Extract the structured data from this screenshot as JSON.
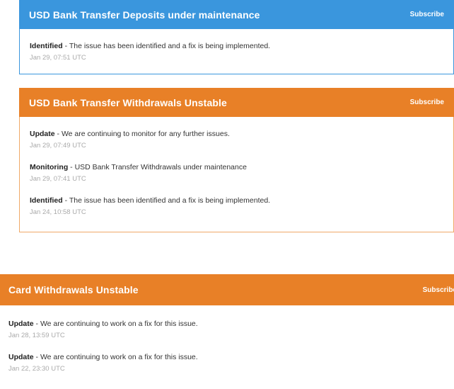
{
  "colors": {
    "maintenance_blue": "#3a96dd",
    "degraded_orange": "#e88027"
  },
  "incidents": [
    {
      "title": "USD Bank Transfer Deposits under maintenance",
      "subscribe_label": "Subscribe",
      "updates": [
        {
          "status": "Identified",
          "message": "The issue has been identified and a fix is being implemented.",
          "time": "Jan 29, 07:51 UTC"
        }
      ]
    },
    {
      "title": "USD Bank Transfer Withdrawals Unstable",
      "subscribe_label": "Subscribe",
      "updates": [
        {
          "status": "Update",
          "message": "We are continuing to monitor for any further issues.",
          "time": "Jan 29, 07:49 UTC"
        },
        {
          "status": "Monitoring",
          "message": "USD Bank Transfer Withdrawals under maintenance",
          "time": "Jan 29, 07:41 UTC"
        },
        {
          "status": "Identified",
          "message": "The issue has been identified and a fix is being implemented.",
          "time": "Jan 24, 10:58 UTC"
        }
      ]
    },
    {
      "title": "Card Withdrawals Unstable",
      "subscribe_label": "Subscribe",
      "updates": [
        {
          "status": "Update",
          "message": "We are continuing to work on a fix for this issue.",
          "time": "Jan 28, 13:59 UTC"
        },
        {
          "status": "Update",
          "message": "We are continuing to work on a fix for this issue.",
          "time": "Jan 22, 23:30 UTC"
        }
      ]
    }
  ]
}
